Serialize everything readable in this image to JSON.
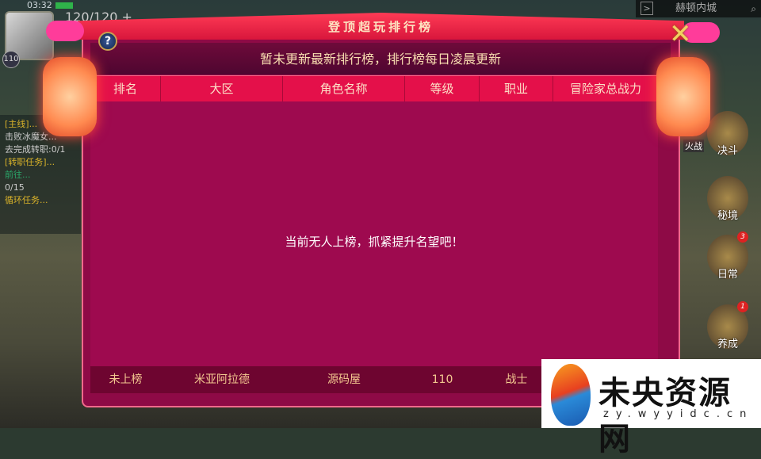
{
  "hud": {
    "time": "03:32",
    "stamina": "120/120 +",
    "level": "110",
    "location": "赫顿内城",
    "arrow": ">",
    "search": "⌕"
  },
  "quests": {
    "lines": [
      "[主线]...",
      "击败冰魔女...",
      "去完成转职:0/1",
      "[转职任务]...",
      "前往...",
      "0/15",
      "循环任务..."
    ]
  },
  "side_icons": [
    {
      "label": "决斗"
    },
    {
      "label": "秘境"
    },
    {
      "label": "日常",
      "badge": "3"
    },
    {
      "label": "养成",
      "badge": "1"
    }
  ],
  "side_extra": "火战",
  "dialog": {
    "title": "登顶超玩排行榜",
    "help": "?",
    "close": "✕",
    "notice": "暂未更新最新排行榜，排行榜每日凌晨更新",
    "columns": [
      "排名",
      "大区",
      "角色名称",
      "等级",
      "职业",
      "冒险家总战力"
    ],
    "empty_message": "当前无人上榜，抓紧提升名望吧！",
    "my_row": [
      "未上榜",
      "米亚阿拉德",
      "源码屋",
      "110",
      "战士",
      ""
    ]
  },
  "watermark": {
    "title": "未央资源网",
    "url": "zy.wyyidc.cn"
  }
}
